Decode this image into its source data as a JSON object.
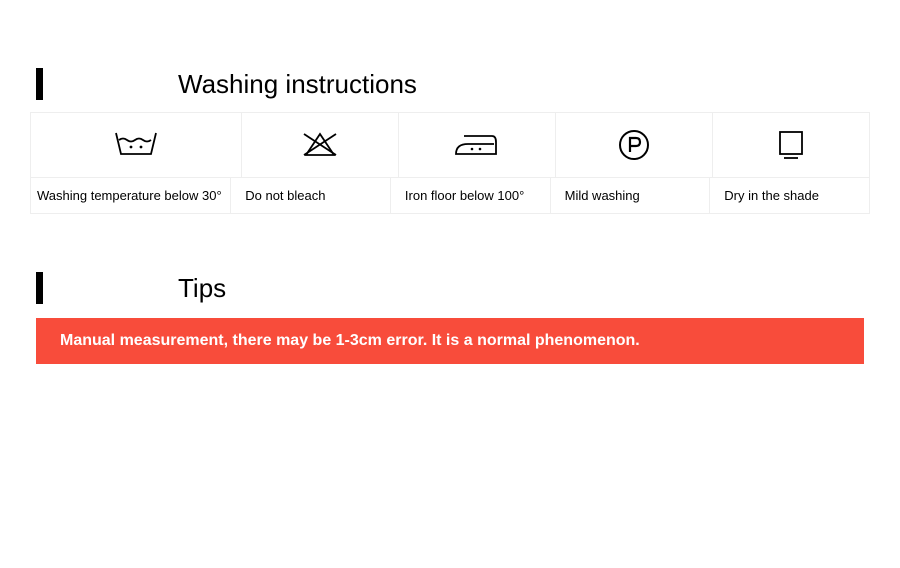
{
  "washing": {
    "title": "Washing instructions",
    "items": [
      {
        "icon": "wash-30-icon",
        "label": "Washing temperature below 30°"
      },
      {
        "icon": "no-bleach-icon",
        "label": "Do not bleach"
      },
      {
        "icon": "iron-low-icon",
        "label": "Iron floor below 100°"
      },
      {
        "icon": "dryclean-p-icon",
        "label": "Mild washing"
      },
      {
        "icon": "dry-shade-icon",
        "label": "Dry in the shade"
      }
    ]
  },
  "tips": {
    "title": "Tips",
    "message": "Manual measurement, there may be 1-3cm error. It is a normal phenomenon."
  }
}
